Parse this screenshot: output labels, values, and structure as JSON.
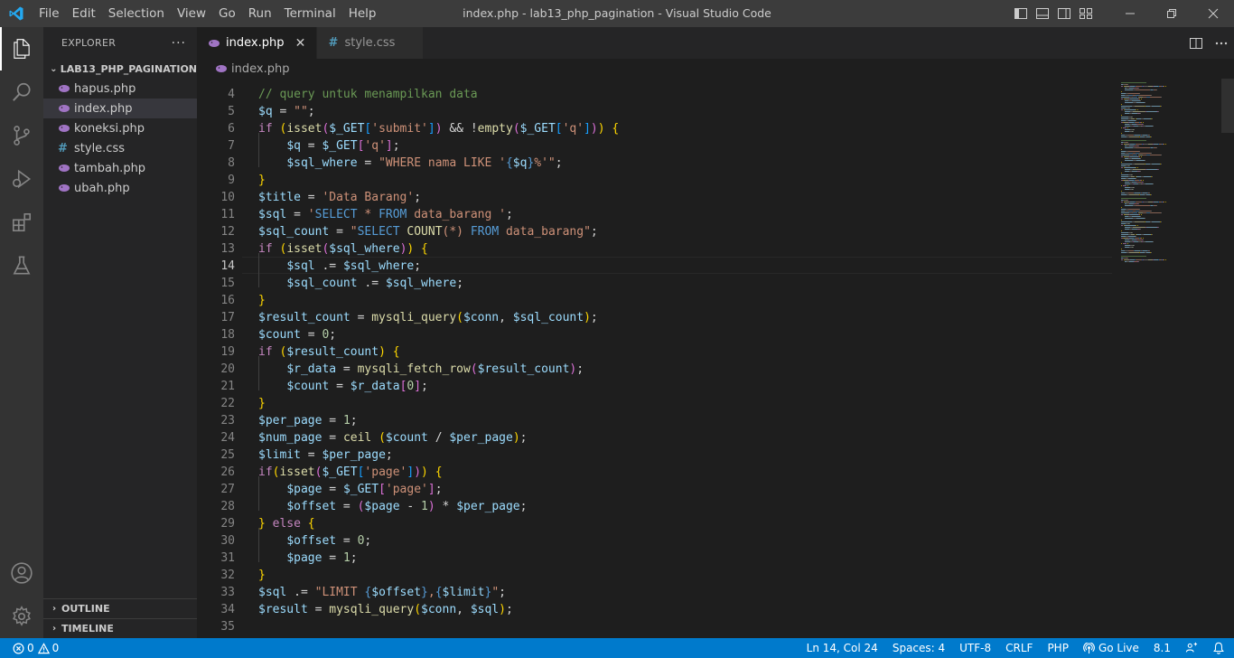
{
  "titlebar": {
    "menu": [
      "File",
      "Edit",
      "Selection",
      "View",
      "Go",
      "Run",
      "Terminal",
      "Help"
    ],
    "window_title": "index.php - lab13_php_pagination - Visual Studio Code",
    "brand_color": "#0078d4"
  },
  "activitybar": {
    "items": [
      "files-icon",
      "search-icon",
      "source-control-icon",
      "run-debug-icon",
      "extensions-icon",
      "testing-icon"
    ],
    "bottom": [
      "account-icon",
      "settings-gear-icon"
    ]
  },
  "sidebar": {
    "header": "EXPLORER",
    "more": "···",
    "folder": "LAB13_PHP_PAGINATION",
    "files": [
      {
        "name": "hapus.php",
        "type": "php"
      },
      {
        "name": "index.php",
        "type": "php"
      },
      {
        "name": "koneksi.php",
        "type": "php"
      },
      {
        "name": "style.css",
        "type": "css"
      },
      {
        "name": "tambah.php",
        "type": "php"
      },
      {
        "name": "ubah.php",
        "type": "php"
      }
    ],
    "outline": "OUTLINE",
    "timeline": "TIMELINE"
  },
  "tabs": [
    {
      "label": "index.php",
      "close": "✕"
    },
    {
      "label": "style.css",
      "icon": "#"
    }
  ],
  "breadcrumb": "index.php",
  "editor": {
    "current_line": 14,
    "line_numbers": [
      "4",
      "5",
      "6",
      "7",
      "8",
      "9",
      "10",
      "11",
      "12",
      "13",
      "14",
      "15",
      "16",
      "17",
      "18",
      "19",
      "20",
      "21",
      "22",
      "23",
      "24",
      "25",
      "26",
      "27",
      "28",
      "29",
      "30",
      "31",
      "32",
      "33",
      "34",
      "35"
    ],
    "lines": [
      [
        [
          "c",
          "// query untuk menampilkan data"
        ]
      ],
      [
        [
          "v",
          "$q"
        ],
        [
          "o",
          " = "
        ],
        [
          "s",
          "\"\""
        ],
        [
          "o",
          ";"
        ]
      ],
      [
        [
          "k",
          "if"
        ],
        [
          "o",
          " "
        ],
        [
          "b1",
          "("
        ],
        [
          "f",
          "isset"
        ],
        [
          "b2",
          "("
        ],
        [
          "v",
          "$_GET"
        ],
        [
          "b3",
          "["
        ],
        [
          "s",
          "'submit'"
        ],
        [
          "b3",
          "]"
        ],
        [
          "b2",
          ")"
        ],
        [
          "o",
          " && !"
        ],
        [
          "f",
          "empty"
        ],
        [
          "b2",
          "("
        ],
        [
          "v",
          "$_GET"
        ],
        [
          "b3",
          "["
        ],
        [
          "s",
          "'q'"
        ],
        [
          "b3",
          "]"
        ],
        [
          "b2",
          ")"
        ],
        [
          "b1",
          ")"
        ],
        [
          "o",
          " "
        ],
        [
          "b1",
          "{"
        ]
      ],
      [
        [
          "o",
          "    "
        ],
        [
          "v",
          "$q"
        ],
        [
          "o",
          " = "
        ],
        [
          "v",
          "$_GET"
        ],
        [
          "b2",
          "["
        ],
        [
          "s",
          "'q'"
        ],
        [
          "b2",
          "]"
        ],
        [
          "o",
          ";"
        ]
      ],
      [
        [
          "o",
          "    "
        ],
        [
          "v",
          "$sql_where"
        ],
        [
          "o",
          " = "
        ],
        [
          "s",
          "\"WHERE nama LIKE '"
        ],
        [
          "kb",
          "{"
        ],
        [
          "v",
          "$q"
        ],
        [
          "kb",
          "}"
        ],
        [
          "s",
          "%'\""
        ],
        [
          "o",
          ";"
        ]
      ],
      [
        [
          "b1",
          "}"
        ]
      ],
      [
        [
          "v",
          "$title"
        ],
        [
          "o",
          " = "
        ],
        [
          "s",
          "'Data Barang'"
        ],
        [
          "o",
          ";"
        ]
      ],
      [
        [
          "v",
          "$sql"
        ],
        [
          "o",
          " = "
        ],
        [
          "s",
          "'"
        ],
        [
          "kb",
          "SELECT"
        ],
        [
          "s",
          " * "
        ],
        [
          "kb",
          "FROM"
        ],
        [
          "s",
          " data_barang '"
        ],
        [
          "o",
          ";"
        ]
      ],
      [
        [
          "v",
          "$sql_count"
        ],
        [
          "o",
          " = "
        ],
        [
          "s",
          "\""
        ],
        [
          "kb",
          "SELECT"
        ],
        [
          "s",
          " "
        ],
        [
          "f",
          "COUNT"
        ],
        [
          "s",
          "(*) "
        ],
        [
          "kb",
          "FROM"
        ],
        [
          "s",
          " data_barang\""
        ],
        [
          "o",
          ";"
        ]
      ],
      [
        [
          "k",
          "if"
        ],
        [
          "o",
          " "
        ],
        [
          "b1",
          "("
        ],
        [
          "f",
          "isset"
        ],
        [
          "b2",
          "("
        ],
        [
          "v",
          "$sql_where"
        ],
        [
          "b2",
          ")"
        ],
        [
          "b1",
          ")"
        ],
        [
          "o",
          " "
        ],
        [
          "b1",
          "{"
        ]
      ],
      [
        [
          "o",
          "    "
        ],
        [
          "v",
          "$sql"
        ],
        [
          "o",
          " .= "
        ],
        [
          "v",
          "$sql_where"
        ],
        [
          "o",
          ";"
        ]
      ],
      [
        [
          "o",
          "    "
        ],
        [
          "v",
          "$sql_count"
        ],
        [
          "o",
          " .= "
        ],
        [
          "v",
          "$sql_where"
        ],
        [
          "o",
          ";"
        ]
      ],
      [
        [
          "b1",
          "}"
        ]
      ],
      [
        [
          "v",
          "$result_count"
        ],
        [
          "o",
          " = "
        ],
        [
          "f",
          "mysqli_query"
        ],
        [
          "b1",
          "("
        ],
        [
          "v",
          "$conn"
        ],
        [
          "o",
          ", "
        ],
        [
          "v",
          "$sql_count"
        ],
        [
          "b1",
          ")"
        ],
        [
          "o",
          ";"
        ]
      ],
      [
        [
          "v",
          "$count"
        ],
        [
          "o",
          " = "
        ],
        [
          "n",
          "0"
        ],
        [
          "o",
          ";"
        ]
      ],
      [
        [
          "k",
          "if"
        ],
        [
          "o",
          " "
        ],
        [
          "b1",
          "("
        ],
        [
          "v",
          "$result_count"
        ],
        [
          "b1",
          ")"
        ],
        [
          "o",
          " "
        ],
        [
          "b1",
          "{"
        ]
      ],
      [
        [
          "o",
          "    "
        ],
        [
          "v",
          "$r_data"
        ],
        [
          "o",
          " = "
        ],
        [
          "f",
          "mysqli_fetch_row"
        ],
        [
          "b2",
          "("
        ],
        [
          "v",
          "$result_count"
        ],
        [
          "b2",
          ")"
        ],
        [
          "o",
          ";"
        ]
      ],
      [
        [
          "o",
          "    "
        ],
        [
          "v",
          "$count"
        ],
        [
          "o",
          " = "
        ],
        [
          "v",
          "$r_data"
        ],
        [
          "b2",
          "["
        ],
        [
          "n",
          "0"
        ],
        [
          "b2",
          "]"
        ],
        [
          "o",
          ";"
        ]
      ],
      [
        [
          "b1",
          "}"
        ]
      ],
      [
        [
          "v",
          "$per_page"
        ],
        [
          "o",
          " = "
        ],
        [
          "n",
          "1"
        ],
        [
          "o",
          ";"
        ]
      ],
      [
        [
          "v",
          "$num_page"
        ],
        [
          "o",
          " = "
        ],
        [
          "f",
          "ceil"
        ],
        [
          "o",
          " "
        ],
        [
          "b1",
          "("
        ],
        [
          "v",
          "$count"
        ],
        [
          "o",
          " / "
        ],
        [
          "v",
          "$per_page"
        ],
        [
          "b1",
          ")"
        ],
        [
          "o",
          ";"
        ]
      ],
      [
        [
          "v",
          "$limit"
        ],
        [
          "o",
          " = "
        ],
        [
          "v",
          "$per_page"
        ],
        [
          "o",
          ";"
        ]
      ],
      [
        [
          "k",
          "if"
        ],
        [
          "b1",
          "("
        ],
        [
          "f",
          "isset"
        ],
        [
          "b2",
          "("
        ],
        [
          "v",
          "$_GET"
        ],
        [
          "b3",
          "["
        ],
        [
          "s",
          "'page'"
        ],
        [
          "b3",
          "]"
        ],
        [
          "b2",
          ")"
        ],
        [
          "b1",
          ")"
        ],
        [
          "o",
          " "
        ],
        [
          "b1",
          "{"
        ]
      ],
      [
        [
          "o",
          "    "
        ],
        [
          "v",
          "$page"
        ],
        [
          "o",
          " = "
        ],
        [
          "v",
          "$_GET"
        ],
        [
          "b2",
          "["
        ],
        [
          "s",
          "'page'"
        ],
        [
          "b2",
          "]"
        ],
        [
          "o",
          ";"
        ]
      ],
      [
        [
          "o",
          "    "
        ],
        [
          "v",
          "$offset"
        ],
        [
          "o",
          " = "
        ],
        [
          "b2",
          "("
        ],
        [
          "v",
          "$page"
        ],
        [
          "o",
          " - "
        ],
        [
          "n",
          "1"
        ],
        [
          "b2",
          ")"
        ],
        [
          "o",
          " * "
        ],
        [
          "v",
          "$per_page"
        ],
        [
          "o",
          ";"
        ]
      ],
      [
        [
          "b1",
          "}"
        ],
        [
          "o",
          " "
        ],
        [
          "k",
          "else"
        ],
        [
          "o",
          " "
        ],
        [
          "b1",
          "{"
        ]
      ],
      [
        [
          "o",
          "    "
        ],
        [
          "v",
          "$offset"
        ],
        [
          "o",
          " = "
        ],
        [
          "n",
          "0"
        ],
        [
          "o",
          ";"
        ]
      ],
      [
        [
          "o",
          "    "
        ],
        [
          "v",
          "$page"
        ],
        [
          "o",
          " = "
        ],
        [
          "n",
          "1"
        ],
        [
          "o",
          ";"
        ]
      ],
      [
        [
          "b1",
          "}"
        ]
      ],
      [
        [
          "v",
          "$sql"
        ],
        [
          "o",
          " .= "
        ],
        [
          "s",
          "\"LIMIT "
        ],
        [
          "kb",
          "{"
        ],
        [
          "v",
          "$offset"
        ],
        [
          "kb",
          "}"
        ],
        [
          "s",
          ","
        ],
        [
          "kb",
          "{"
        ],
        [
          "v",
          "$limit"
        ],
        [
          "kb",
          "}"
        ],
        [
          "s",
          "\""
        ],
        [
          "o",
          ";"
        ]
      ],
      [
        [
          "v",
          "$result"
        ],
        [
          "o",
          " = "
        ],
        [
          "f",
          "mysqli_query"
        ],
        [
          "b1",
          "("
        ],
        [
          "v",
          "$conn"
        ],
        [
          "o",
          ", "
        ],
        [
          "v",
          "$sql"
        ],
        [
          "b1",
          ")"
        ],
        [
          "o",
          ";"
        ]
      ],
      []
    ]
  },
  "statusbar": {
    "errors": "0",
    "warnings": "0",
    "position": "Ln 14, Col 24",
    "spaces": "Spaces: 4",
    "encoding": "UTF-8",
    "eol": "CRLF",
    "language": "PHP",
    "golive": "Go Live",
    "php_version": "8.1",
    "color": "#007acc"
  }
}
